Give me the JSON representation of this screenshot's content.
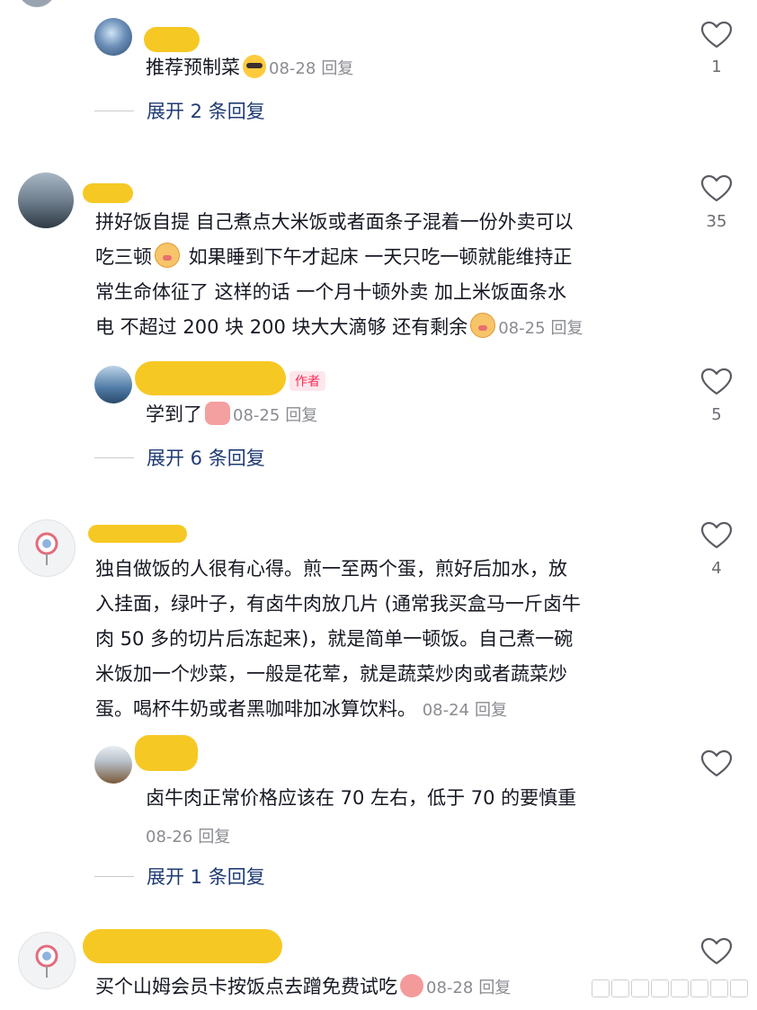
{
  "comments": [
    {
      "replies": [
        {
          "text": "推荐预制菜",
          "date": "08-28",
          "reply_label": "回复",
          "likes": "1"
        }
      ],
      "expand_label": "展开 2 条回复"
    },
    {
      "lines": [
        "拼好饭自提  自己煮点大米饭或者面条子混着一份外卖可以",
        "吃三顿",
        "  如果睡到下午才起床  一天只吃一顿就能维持正",
        "常生命体征了  这样的话 一个月十顿外卖  加上米饭面条水",
        "电  不超过 200 块  200 块大大滴够 还有剩余"
      ],
      "date": "08-25",
      "reply_label": "回复",
      "likes": "35",
      "replies": [
        {
          "author_badge": "作者",
          "text": "学到了",
          "date": "08-25",
          "reply_label": "回复",
          "likes": "5"
        }
      ],
      "expand_label": "展开 6 条回复"
    },
    {
      "lines": [
        "独自做饭的人很有心得。煎一至两个蛋，煎好后加水，放",
        "入挂面，绿叶子，有卤牛肉放几片 (通常我买盒马一斤卤牛",
        "肉 50 多的切片后冻起来)，就是简单一顿饭。自己煮一碗",
        "米饭加一个炒菜，一般是花荤，就是蔬菜炒肉或者蔬菜炒",
        "蛋。喝杯牛奶或者黑咖啡加冰算饮料。"
      ],
      "date": "08-24",
      "reply_label": "回复",
      "likes": "4",
      "replies": [
        {
          "text": "卤牛肉正常价格应该在 70 左右，低于 70 的要慎重",
          "date": "08-26",
          "reply_label": "回复"
        }
      ],
      "expand_label": "展开 1 条回复"
    },
    {
      "lines": [
        "买个山姆会员卡按饭点去蹭免费试吃"
      ],
      "date": "08-28",
      "reply_label": "回复"
    }
  ],
  "icons": {
    "like": "heart-outline-icon"
  },
  "colors": {
    "expand_link": "#1f3b73",
    "meta": "#8a8b91",
    "redaction": "#f5c518",
    "author_badge": "#fe2c55"
  }
}
